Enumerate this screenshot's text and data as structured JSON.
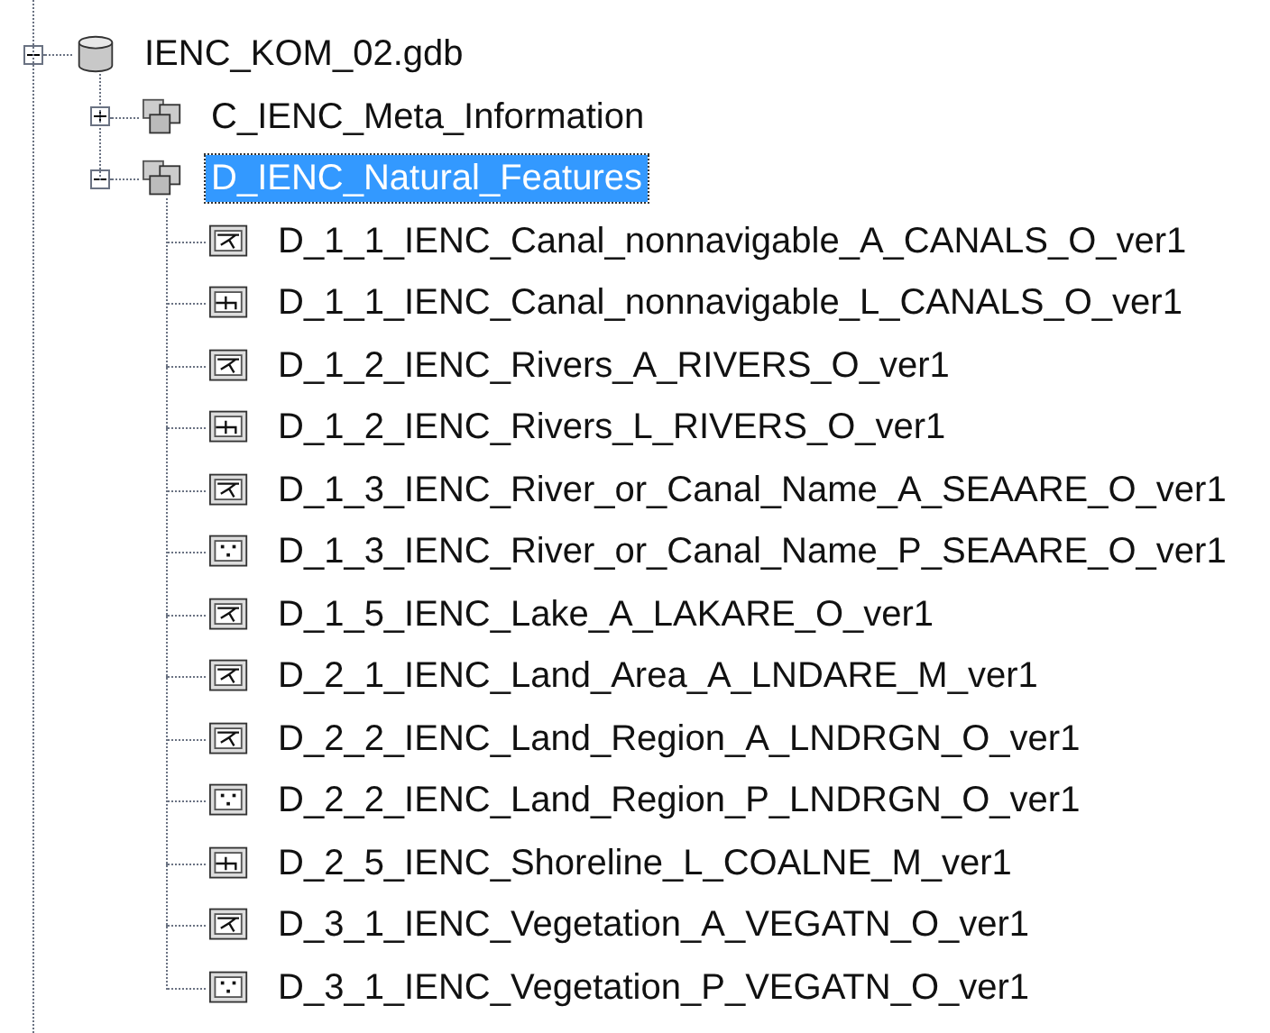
{
  "tree": [
    {
      "label": "IENC_KOM_02.gdb",
      "kind": "database",
      "expanded": true,
      "selected": false,
      "children": [
        {
          "label": "C_IENC_Meta_Information",
          "kind": "dataset",
          "expanded": false,
          "selected": false
        },
        {
          "label": "D_IENC_Natural_Features",
          "kind": "dataset",
          "expanded": true,
          "selected": true,
          "children": [
            {
              "label": "D_1_1_IENC_Canal_nonnavigable_A_CANALS_O_ver1",
              "kind": "polygon",
              "selected": false
            },
            {
              "label": "D_1_1_IENC_Canal_nonnavigable_L_CANALS_O_ver1",
              "kind": "line",
              "selected": false
            },
            {
              "label": "D_1_2_IENC_Rivers_A_RIVERS_O_ver1",
              "kind": "polygon",
              "selected": false
            },
            {
              "label": "D_1_2_IENC_Rivers_L_RIVERS_O_ver1",
              "kind": "line",
              "selected": false
            },
            {
              "label": "D_1_3_IENC_River_or_Canal_Name_A_SEAARE_O_ver1",
              "kind": "polygon",
              "selected": false
            },
            {
              "label": "D_1_3_IENC_River_or_Canal_Name_P_SEAARE_O_ver1",
              "kind": "point",
              "selected": false
            },
            {
              "label": "D_1_5_IENC_Lake_A_LAKARE_O_ver1",
              "kind": "polygon",
              "selected": false
            },
            {
              "label": "D_2_1_IENC_Land_Area_A_LNDARE_M_ver1",
              "kind": "polygon",
              "selected": false
            },
            {
              "label": "D_2_2_IENC_Land_Region_A_LNDRGN_O_ver1",
              "kind": "polygon",
              "selected": false
            },
            {
              "label": "D_2_2_IENC_Land_Region_P_LNDRGN_O_ver1",
              "kind": "point",
              "selected": false
            },
            {
              "label": "D_2_5_IENC_Shoreline_L_COALNE_M_ver1",
              "kind": "line",
              "selected": false
            },
            {
              "label": "D_3_1_IENC_Vegetation_A_VEGATN_O_ver1",
              "kind": "polygon",
              "selected": false
            },
            {
              "label": "D_3_1_IENC_Vegetation_P_VEGATN_O_ver1",
              "kind": "point",
              "selected": false
            }
          ]
        }
      ]
    }
  ]
}
